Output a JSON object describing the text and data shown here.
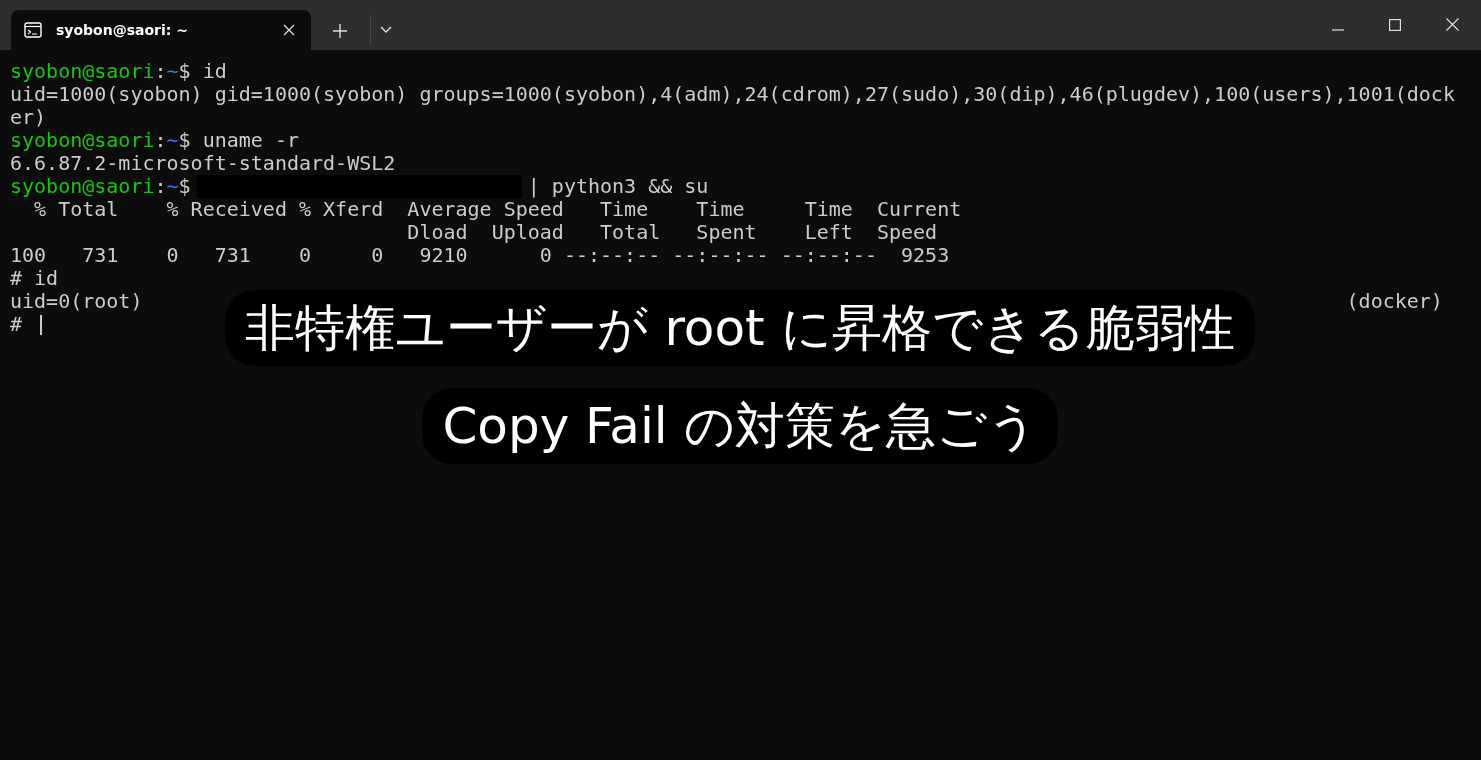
{
  "tabs": [
    {
      "title": "syobon@saori: ~",
      "selected": true
    }
  ],
  "terminal": {
    "lines": [
      {
        "kind": "prompt",
        "user": "syobon@saori",
        "sep": ":",
        "path": "~",
        "symbol": "$",
        "command": "id",
        "redacted": false
      },
      {
        "kind": "output",
        "text": "uid=1000(syobon) gid=1000(syobon) groups=1000(syobon),4(adm),24(cdrom),27(sudo),30(dip),46(plugdev),100(users),1001(dock"
      },
      {
        "kind": "output",
        "text": "er)"
      },
      {
        "kind": "prompt",
        "user": "syobon@saori",
        "sep": ":",
        "path": "~",
        "symbol": "$",
        "command": "uname -r",
        "redacted": false
      },
      {
        "kind": "output",
        "text": "6.6.87.2-microsoft-standard-WSL2"
      },
      {
        "kind": "prompt",
        "user": "syobon@saori",
        "sep": ":",
        "path": "~",
        "symbol": "$",
        "command": "| python3 && su",
        "redacted": true
      },
      {
        "kind": "output",
        "text": "  % Total    % Received % Xferd  Average Speed   Time    Time     Time  Current"
      },
      {
        "kind": "output",
        "text": "                                 Dload  Upload   Total   Spent    Left  Speed"
      },
      {
        "kind": "output",
        "text": "100   731    0   731    0     0   9210      0 --:--:-- --:--:-- --:--:--  9253"
      },
      {
        "kind": "output",
        "text": "# id"
      },
      {
        "kind": "covered",
        "head": "uid=0(root)",
        "tail": "(docker)"
      },
      {
        "kind": "cursor",
        "text": "#"
      }
    ]
  },
  "caption": [
    "非特権ユーザーが root に昇格できる脆弱性",
    "Copy Fail の対策を急ごう"
  ]
}
